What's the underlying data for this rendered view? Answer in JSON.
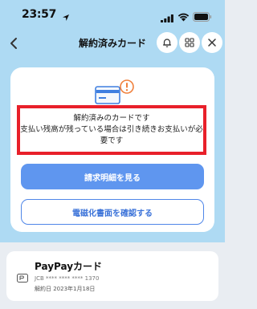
{
  "status_bar": {
    "time": "23:57"
  },
  "nav": {
    "title": "解約済みカード"
  },
  "notice": {
    "line1": "解約済みのカードです",
    "line2": "支払い残高が残っている場合は引き続きお支払いが必要です"
  },
  "buttons": {
    "view_statement": "請求明細を見る",
    "check_electronic_docs": "電磁化書面を確認する"
  },
  "card_item": {
    "name": "PayPayカード",
    "number": "JCB **** **** **** 1370",
    "cancel_date": "解約日 2023年1月18日"
  },
  "colors": {
    "header_bg": "#aedaf3",
    "primary": "#5f96ef",
    "alert_border": "#e8202a",
    "alert_badge": "#f0803c"
  },
  "icons": [
    "location-arrow-icon",
    "signal-icon",
    "wifi-icon",
    "battery-icon",
    "back-chevron-icon",
    "bell-icon",
    "grid-icon",
    "close-icon",
    "credit-card-alert-icon",
    "paypay-card-icon"
  ]
}
